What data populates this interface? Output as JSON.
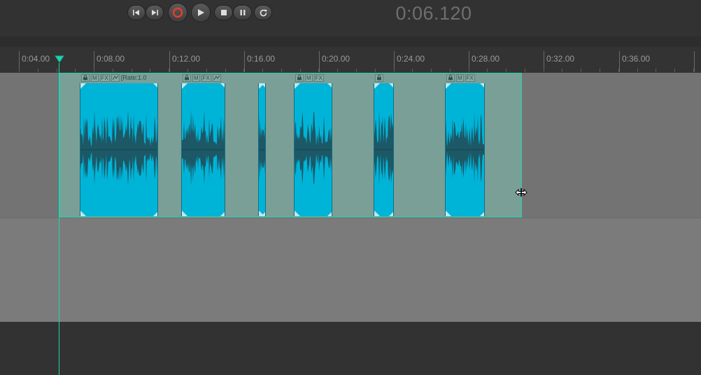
{
  "transport": {
    "time": "0:06.120",
    "buttons": [
      "skip-to-start",
      "skip-to-end",
      "record",
      "play",
      "stop",
      "pause",
      "loop"
    ]
  },
  "ruler": {
    "labels": [
      "0:04.00",
      "0:08.00",
      "0:12.00",
      "0:16.00",
      "0:20.00",
      "0:24.00",
      "0:28.00",
      "0:32.00",
      "0:36.00"
    ]
  },
  "clips": [
    {
      "header": [
        "M",
        "FX"
      ],
      "label": "[Rate:1.0"
    },
    {
      "header": [
        "M",
        "FX"
      ],
      "label": ""
    },
    {
      "header": [],
      "label": ""
    },
    {
      "header": [
        "M",
        "FX"
      ],
      "label": ""
    },
    {
      "header": [],
      "label": ""
    },
    {
      "header": [
        "M",
        "FX"
      ],
      "label": ""
    }
  ],
  "colors": {
    "accent": "#1fd3b0",
    "clip": "#00b4d8",
    "waveform": "#1c5866",
    "group_bg": "#7a9f97"
  }
}
